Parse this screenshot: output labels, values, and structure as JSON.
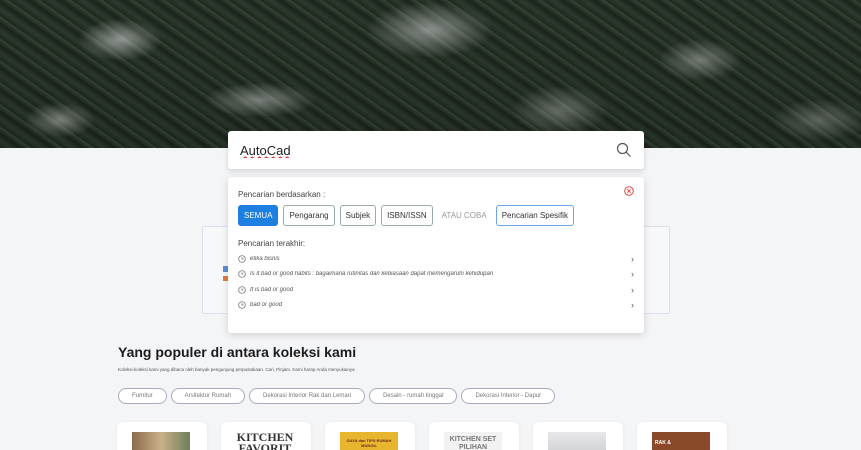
{
  "search": {
    "value": "AutoCad"
  },
  "filter_panel": {
    "label": "Pencarian berdasarkan :",
    "filters": [
      "SEMUA",
      "Pengarang",
      "Subjek",
      "ISBN/ISSN"
    ],
    "or_label": "ATAU COBA",
    "special_label": "Pencarian Spesifik"
  },
  "recent": {
    "label": "Pencarian terakhir:",
    "items": [
      "etika bisnis",
      "Is it bad or good habits : bagaimana rutinitas dan kebiasaan dapat memengaruhi kehidupan",
      "It is bad or good",
      "bad or good"
    ]
  },
  "popular": {
    "title": "Yang populer di antara koleksi kami",
    "subtitle": "Koleksi-koleksi kami yang dibaca oleh banyak pengunjung perpustakaan. Cari, Pinjam. Kami harap Anda menyukainya",
    "chips": [
      "Furnitur",
      "Arsitektur Rumah",
      "Dekorasi Interior Rak dan Lemari",
      "Desain - rumah tinggal",
      "Dekorasi Interior - Dapur"
    ]
  },
  "books": {
    "cover_2_text": "KITCHEN FAVORIT",
    "cover_3_text": "GAYA dan TIPS RUMAH MUNGIL",
    "cover_4_text": "KITCHEN SET PILIHAN",
    "cover_6_text": "RAK &"
  },
  "colors": {
    "accent": "#1d7fe0",
    "close": "#e04848"
  }
}
